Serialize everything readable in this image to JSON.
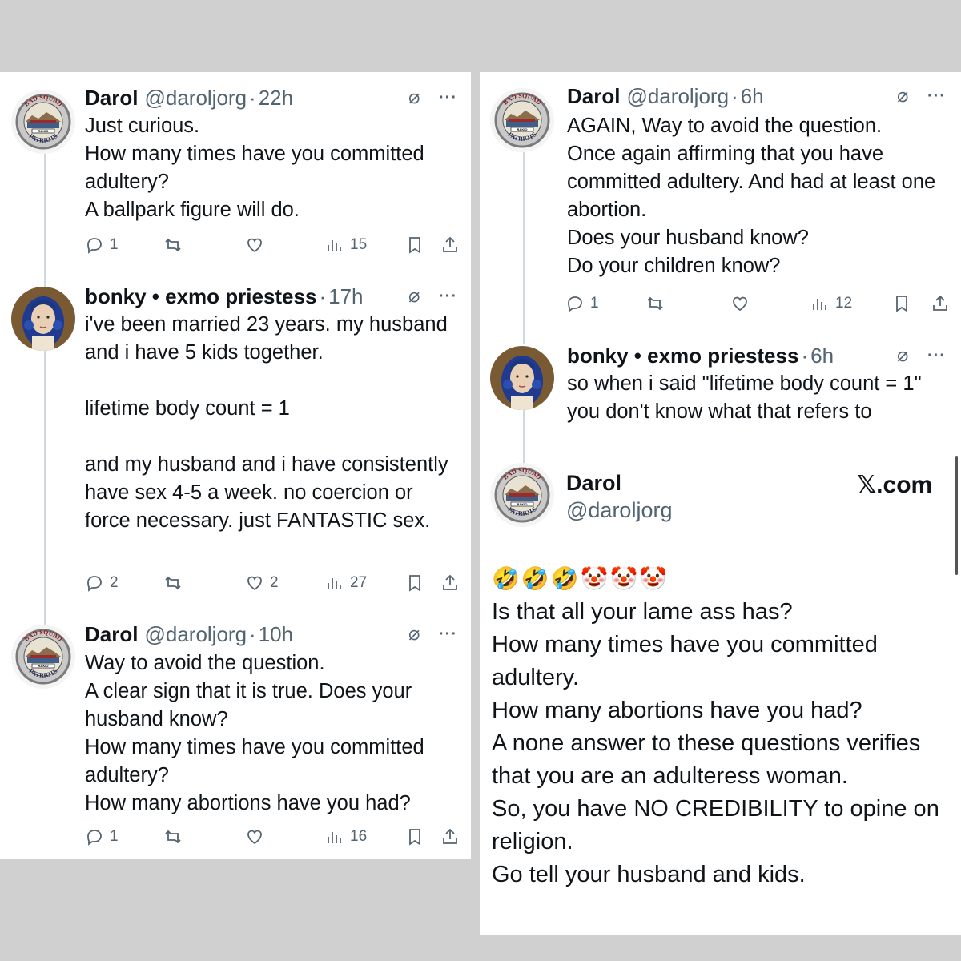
{
  "colors": {
    "text": "#0f1419",
    "muted": "#536471",
    "line": "#cfd9de",
    "background": "#d0d0d0"
  },
  "left": {
    "tweets": [
      {
        "name": "Darol",
        "handle": "@daroljorg",
        "time": "22h",
        "text": "Just curious.\nHow many times have you committed adultery?\nA ballpark figure will do.",
        "replies": "1",
        "reposts": "",
        "likes": "",
        "views": "15"
      },
      {
        "name": "bonky • exmo priestess",
        "handle": "",
        "time": "17h",
        "text": "i've been married 23 years. my husband and i have 5 kids together.\n\nlifetime body count = 1\n\nand my husband and i have consistently have sex 4-5 a week. no coercion or force necessary. just FANTASTIC sex.",
        "replies": "2",
        "reposts": "",
        "likes": "2",
        "views": "27"
      },
      {
        "name": "Darol",
        "handle": "@daroljorg",
        "time": "10h",
        "text": "Way to avoid the question.\nA clear sign that it is true. Does your husband know?\nHow many times have you committed adultery?\nHow many abortions have you had?",
        "replies": "1",
        "reposts": "",
        "likes": "",
        "views": "16"
      }
    ]
  },
  "right": {
    "tweets": [
      {
        "name": "Darol",
        "handle": "@daroljorg",
        "time": "6h",
        "text": "AGAIN, Way to avoid the question.\nOnce again affirming that you have committed adultery. And had at least one abortion.\nDoes your husband know?\nDo your children know?",
        "replies": "1",
        "reposts": "",
        "likes": "",
        "views": "12"
      },
      {
        "name": "bonky • exmo priestess",
        "handle": "",
        "time": "6h",
        "text": "so when i said \"lifetime body count = 1\" you don't know what that refers to"
      }
    ],
    "card": {
      "name": "Darol",
      "handle": "@daroljorg",
      "brand": "𝕏.com",
      "emojis": "🤣🤣🤣🤡🤡🤡",
      "text": "Is that all your lame ass has?\nHow many times have you committed adultery.\nHow many abortions have you had?\nA none answer to these questions verifies that you are an adulteress woman.\nSo, you have NO CREDIBILITY to opine on religion.\nGo tell your husband and kids."
    }
  },
  "icons": {
    "grok": "grok-icon",
    "more": "more-icon",
    "reply": "reply-icon",
    "repost": "repost-icon",
    "like": "like-icon",
    "views": "views-icon",
    "bookmark": "bookmark-icon",
    "share": "share-icon"
  },
  "avatar_text": {
    "darol_top": "BAD SQUAD",
    "darol_bottom": "PATRIOTS",
    "darol_plate": "RAKIO"
  },
  "ui": {
    "more_glyph": "···",
    "dot": "·"
  }
}
